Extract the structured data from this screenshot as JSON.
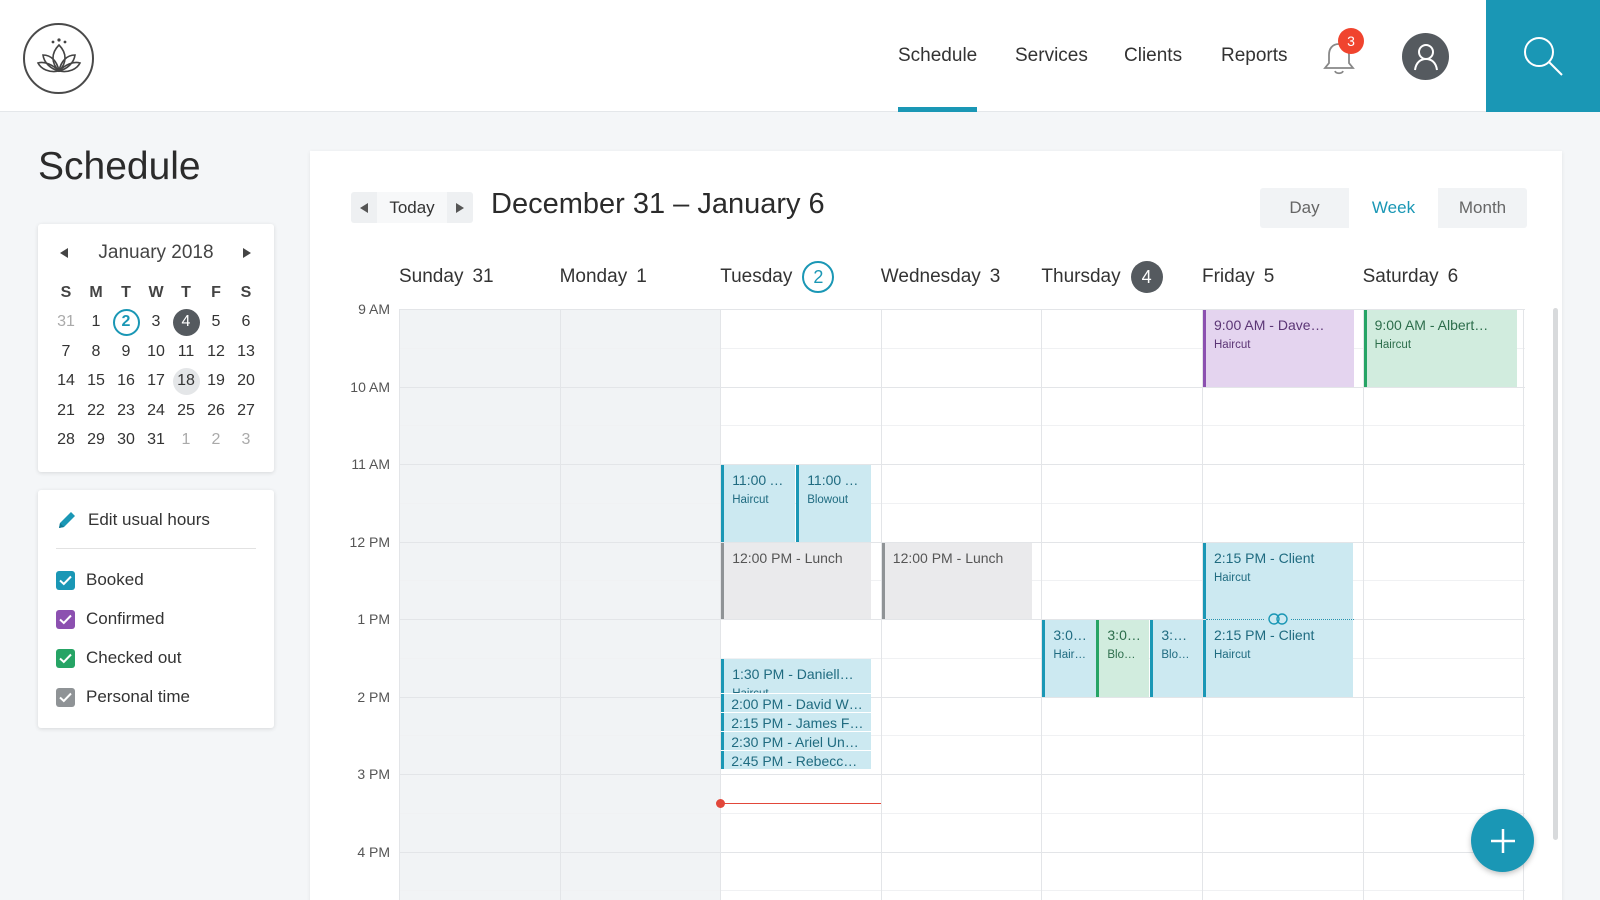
{
  "nav": {
    "items": [
      "Schedule",
      "Services",
      "Clients",
      "Reports"
    ],
    "active": "Schedule",
    "notification_count": "3"
  },
  "sidebar": {
    "title": "Schedule",
    "mini_calendar": {
      "month_label": "January 2018",
      "weekdays": [
        "S",
        "M",
        "T",
        "W",
        "T",
        "F",
        "S"
      ],
      "weeks": [
        [
          "31",
          "1",
          "2",
          "3",
          "4",
          "5",
          "6"
        ],
        [
          "7",
          "8",
          "9",
          "10",
          "11",
          "12",
          "13"
        ],
        [
          "14",
          "15",
          "16",
          "17",
          "18",
          "19",
          "20"
        ],
        [
          "21",
          "22",
          "23",
          "24",
          "25",
          "26",
          "27"
        ],
        [
          "28",
          "29",
          "30",
          "31",
          "1",
          "2",
          "3"
        ]
      ],
      "today": "2",
      "selected": "4",
      "hovered": "18"
    },
    "edit_hours_label": "Edit usual hours",
    "filters": [
      {
        "label": "Booked",
        "color": "#1a97b5",
        "checked": true
      },
      {
        "label": "Confirmed",
        "color": "#8c50b0",
        "checked": true
      },
      {
        "label": "Checked out",
        "color": "#26a465",
        "checked": true
      },
      {
        "label": "Personal time",
        "color": "#8f9396",
        "checked": true
      }
    ]
  },
  "toolbar": {
    "today_label": "Today",
    "range_title": "December 31 – January 6",
    "views": [
      "Day",
      "Week",
      "Month"
    ],
    "active_view": "Week"
  },
  "week": {
    "days": [
      {
        "name": "Sunday",
        "num": "31"
      },
      {
        "name": "Monday",
        "num": "1"
      },
      {
        "name": "Tuesday",
        "num": "2",
        "marker": "today"
      },
      {
        "name": "Wednesday",
        "num": "3"
      },
      {
        "name": "Thursday",
        "num": "4",
        "marker": "selected"
      },
      {
        "name": "Friday",
        "num": "5"
      },
      {
        "name": "Saturday",
        "num": "6"
      }
    ],
    "hours": [
      "9 AM",
      "10 AM",
      "11 AM",
      "12 PM",
      "1 PM",
      "2 PM",
      "3 PM",
      "4 PM"
    ],
    "events": [
      {
        "day": 5,
        "time": "9:00 AM",
        "title": "Dave…",
        "service": "Haircut",
        "color": "purple"
      },
      {
        "day": 6,
        "time": "9:00 AM",
        "title": "Albert…",
        "service": "Haircut",
        "color": "green"
      },
      {
        "day": 2,
        "time": "11:00 AM",
        "title": "",
        "service": "Haircut",
        "color": "blue"
      },
      {
        "day": 2,
        "time": "11:00 AM",
        "title": "",
        "service": "Blowout",
        "color": "blue"
      },
      {
        "day": 2,
        "time": "12:00 PM",
        "title": "Lunch",
        "service": "",
        "color": "gray"
      },
      {
        "day": 3,
        "time": "12:00 PM",
        "title": "Lunch",
        "service": "",
        "color": "gray"
      },
      {
        "day": 5,
        "time": "2:15 PM",
        "title": "Client",
        "service": "Haircut",
        "color": "blue"
      },
      {
        "day": 5,
        "time": "2:15 PM",
        "title": "Client",
        "service": "Haircut",
        "color": "blue"
      },
      {
        "day": 4,
        "time": "3:00…",
        "title": "",
        "service": "Haircut",
        "color": "blue"
      },
      {
        "day": 4,
        "time": "3:00…",
        "title": "",
        "service": "Blow…",
        "color": "green"
      },
      {
        "day": 4,
        "time": "3:00…",
        "title": "",
        "service": "Blow…",
        "color": "blue"
      },
      {
        "day": 2,
        "time": "1:30 PM",
        "title": "Daniell…",
        "service": "Haircut",
        "color": "blue"
      },
      {
        "day": 2,
        "time": "2:00 PM",
        "title": "David Wi…",
        "service": "",
        "color": "blue"
      },
      {
        "day": 2,
        "time": "2:15 PM",
        "title": "James Fa…",
        "service": "",
        "color": "blue"
      },
      {
        "day": 2,
        "time": "2:30 PM",
        "title": "Ariel Und…",
        "service": "",
        "color": "blue"
      },
      {
        "day": 2,
        "time": "2:45 PM",
        "title": "Rebecca…",
        "service": "",
        "color": "blue"
      }
    ]
  }
}
